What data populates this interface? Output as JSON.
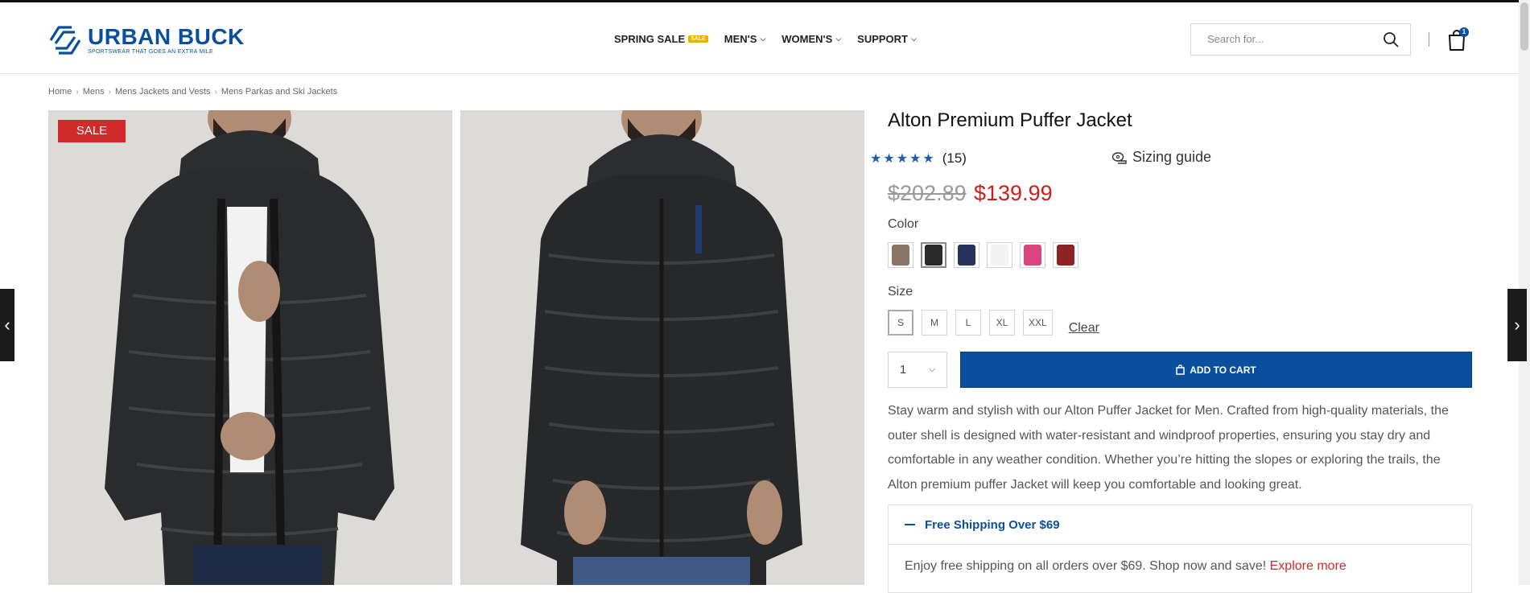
{
  "brand": {
    "name": "URBAN BUCK",
    "tagline": "SPORTSWEAR THAT GOES AN EXTRA MILE",
    "accent": "#0a4f9c"
  },
  "nav": {
    "items": [
      {
        "label": "SPRING SALE",
        "badge": "SALE",
        "chevron": false
      },
      {
        "label": "MEN'S",
        "badge": "",
        "chevron": true
      },
      {
        "label": "WOMEN'S",
        "badge": "",
        "chevron": true
      },
      {
        "label": "SUPPORT",
        "badge": "",
        "chevron": true
      }
    ]
  },
  "search": {
    "placeholder": "Search for...",
    "icon": "search-icon"
  },
  "cart": {
    "count": "1",
    "icon": "shopping-bag-icon"
  },
  "breadcrumb": [
    "Home",
    "Mens",
    "Mens Jackets and Vests",
    "Mens Parkas and Ski Jackets"
  ],
  "gallery": {
    "sale_badge": "SALE",
    "prev_icon": "chevron-left-icon",
    "next_icon": "chevron-right-icon"
  },
  "product": {
    "title": "Alton Premium Puffer Jacket",
    "rating_stars": 5,
    "rating_count": "(15)",
    "sizing_guide": "Sizing guide",
    "price_old": "$202.89",
    "price_new": "$139.99",
    "price_color": "#c91f1f",
    "color_label": "Color",
    "colors": [
      {
        "name": "tan",
        "hex": "#8a7566",
        "selected": false
      },
      {
        "name": "black",
        "hex": "#2a2a2a",
        "selected": true
      },
      {
        "name": "navy",
        "hex": "#26345a",
        "selected": false
      },
      {
        "name": "white",
        "hex": "#f4f4f4",
        "selected": false
      },
      {
        "name": "pink",
        "hex": "#d9467e",
        "selected": false
      },
      {
        "name": "red",
        "hex": "#8c2424",
        "selected": false
      }
    ],
    "size_label": "Size",
    "sizes": [
      "S",
      "M",
      "L",
      "XL",
      "XXL"
    ],
    "selected_size": "S",
    "clear_label": "Clear",
    "quantity": "1",
    "add_to_cart": "ADD TO CART",
    "description": "Stay warm and stylish with our Alton Puffer Jacket for Men. Crafted from high-quality materials, the outer shell is designed with water-resistant and windproof properties, ensuring you stay dry and comfortable in any weather condition. Whether you’re hitting the slopes or exploring the trails, the Alton premium puffer Jacket will keep you comfortable and looking great."
  },
  "shipping": {
    "title": "Free Shipping Over $69",
    "text": "Enjoy free shipping on all orders over $69. Shop now and save!",
    "link": "Explore more"
  }
}
